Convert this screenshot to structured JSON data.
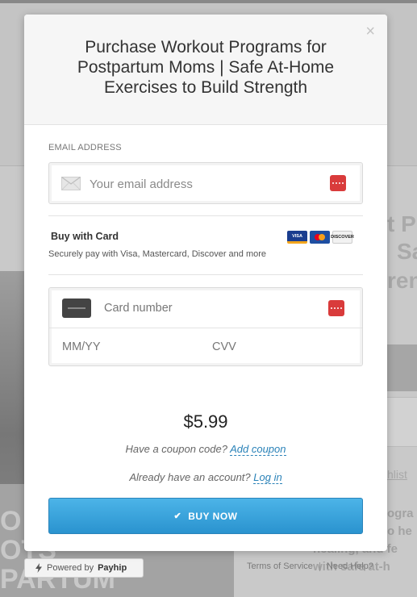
{
  "modal": {
    "title": "Purchase Workout Programs for Postpartum Moms | Safe At-Home Exercises to Build Strength",
    "close_symbol": "×"
  },
  "email": {
    "label": "EMAIL ADDRESS",
    "placeholder": "Your email address",
    "icon": "envelope-icon"
  },
  "payment": {
    "title": "Buy with Card",
    "subtitle": "Securely pay with Visa, Mastercard, Discover and more",
    "card_brands": [
      "VISA",
      "Mastercard",
      "DISCOVER"
    ],
    "card_number_placeholder": "Card number",
    "expiry_placeholder": "MM/YY",
    "cvv_placeholder": "CVV"
  },
  "price": "$5.99",
  "coupon": {
    "prompt": "Have a coupon code?",
    "link": "Add coupon"
  },
  "account": {
    "prompt": "Already have an account?",
    "link": "Log in"
  },
  "buy_button": {
    "label": "BUY NOW",
    "check": "✔"
  },
  "powered_by": {
    "prefix": "Powered by",
    "brand": "Payhip"
  },
  "background": {
    "footer_links": [
      "Terms of Service",
      "Need Help?"
    ],
    "wishlist_fragment": "hlist",
    "title_fragments": [
      "t Pr",
      "Sa",
      "ren"
    ],
    "desc_lines": [
      "ogra",
      "o he",
      "healing, and fe",
      "with safe at-h"
    ],
    "left_lines": [
      "O",
      "OTS",
      "PARTUM"
    ]
  },
  "colors": {
    "accent": "#2a93cf",
    "error_icon": "#d93b3b",
    "link": "#2a82b8"
  }
}
